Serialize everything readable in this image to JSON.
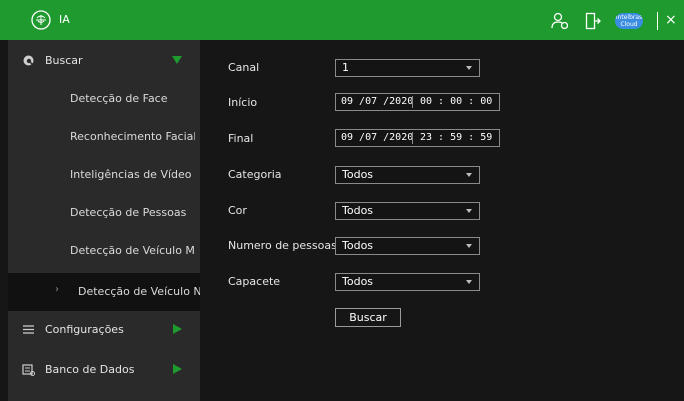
{
  "header": {
    "app_title": "IA",
    "cloud_badge": [
      "Intelbras",
      "Cloud"
    ],
    "icons": [
      "ai-chip-icon",
      "user-settings-icon",
      "logout-icon",
      "cloud-icon",
      "close-icon"
    ],
    "close_glyph": "×",
    "accent_color": "#1e9a2e"
  },
  "sidebar": {
    "buscar": {
      "label": "Buscar",
      "icon": "search-icon",
      "expanded": true
    },
    "subitems": [
      {
        "label": "Detecção de Face"
      },
      {
        "label": "Reconhecimento Facial"
      },
      {
        "label": "Inteligências de Vídeo"
      },
      {
        "label": "Detecção de Pessoas"
      },
      {
        "label": "Detecção de Veículo Mo..."
      },
      {
        "label": "Detecção de Veículo Nã...",
        "active": true,
        "chevron": "›"
      }
    ],
    "configuracoes": {
      "label": "Configurações",
      "icon": "list-icon"
    },
    "banco": {
      "label": "Banco de Dados",
      "icon": "database-icon"
    }
  },
  "form": {
    "canal": {
      "label": "Canal",
      "value": "1"
    },
    "inicio": {
      "label": "Início",
      "date": "09 /07 /2020",
      "time": "00 : 00 : 00"
    },
    "final": {
      "label": "Final",
      "date": "09 /07 /2020",
      "time": "23 : 59 : 59"
    },
    "categoria": {
      "label": "Categoria",
      "value": "Todos"
    },
    "cor": {
      "label": "Cor",
      "value": "Todos"
    },
    "numero_pessoas": {
      "label": "Numero de pessoas",
      "value": "Todos"
    },
    "capacete": {
      "label": "Capacete",
      "value": "Todos"
    },
    "search_button": "Buscar"
  }
}
